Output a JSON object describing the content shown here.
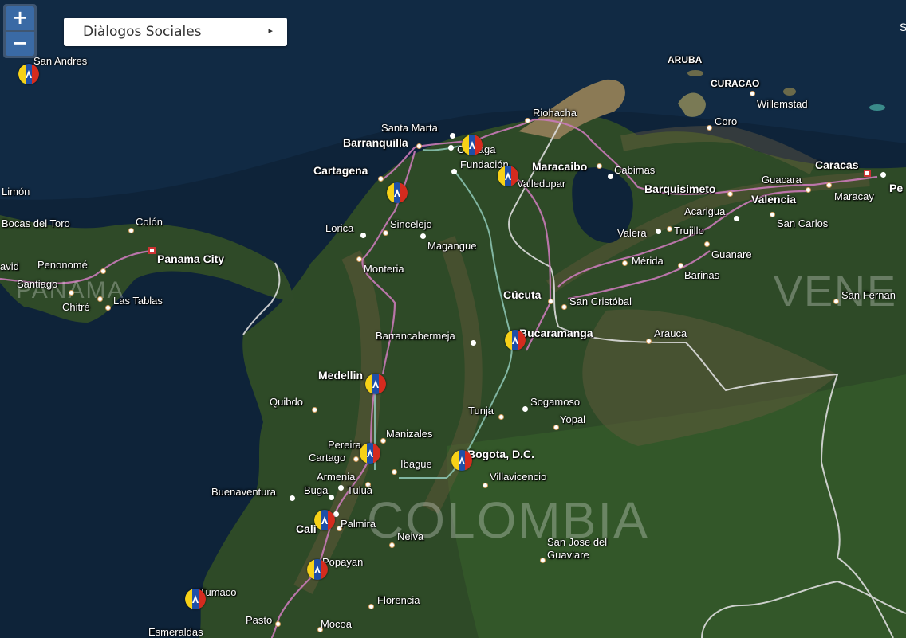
{
  "map": {
    "zoom_in_label": "+",
    "zoom_out_label": "−",
    "layer_dropdown": {
      "label": "Diàlogos Sociales",
      "arrow": "▸"
    },
    "country_labels": [
      "COLOMBIA",
      "PANAMA",
      "VENE"
    ],
    "edge_text": "S",
    "colors": {
      "road": "#c97ab8",
      "river": "#8fc9b8",
      "border": "#dddddd",
      "flag_yellow": "#f7d117",
      "flag_blue": "#1f4fa8",
      "flag_red": "#d52b1e"
    },
    "marker_icon": "dialogos-sociales-marker-icon",
    "places": [
      "San Andres",
      "ARUBA",
      "CURACAO",
      "Willemstad",
      "Riohacha",
      "Coro",
      "Santa Marta",
      "Barranquilla",
      "Ciénaga",
      "Fundación",
      "Maracaibo",
      "Cabimas",
      "Cartagena",
      "Valledupar",
      "Caracas",
      "Guacara",
      "Maracay",
      "Valencia",
      "Barquisimeto",
      "Acarigua",
      "San Carlos",
      "Limón",
      "Bocas del Toro",
      "Colón",
      "Panama City",
      "Penonomé",
      "avid",
      "Santiago",
      "Chitré",
      "Las Tablas",
      "Lorica",
      "Sincelejo",
      "Magangue",
      "Monteria",
      "Valera",
      "Trujillo",
      "Mérida",
      "Guanare",
      "Barinas",
      "Cúcuta",
      "San Cristóbal",
      "San Fernan",
      "Barrancabermeja",
      "Bucaramanga",
      "Arauca",
      "Medellin",
      "Quibdo",
      "Sogamoso",
      "Tunja",
      "Yopal",
      "Manizales",
      "Pereira",
      "Cartago",
      "Armenia",
      "Ibague",
      "Bogota, D.C.",
      "Villavicencio",
      "Buenaventura",
      "Buga",
      "Tuluá",
      "Cali",
      "Palmira",
      "Neiva",
      "San Jose del",
      "Guaviare",
      "Popayan",
      "Tumaco",
      "Florencia",
      "Pasto",
      "Mocoa",
      "Esmeraldas",
      "Pe"
    ]
  }
}
